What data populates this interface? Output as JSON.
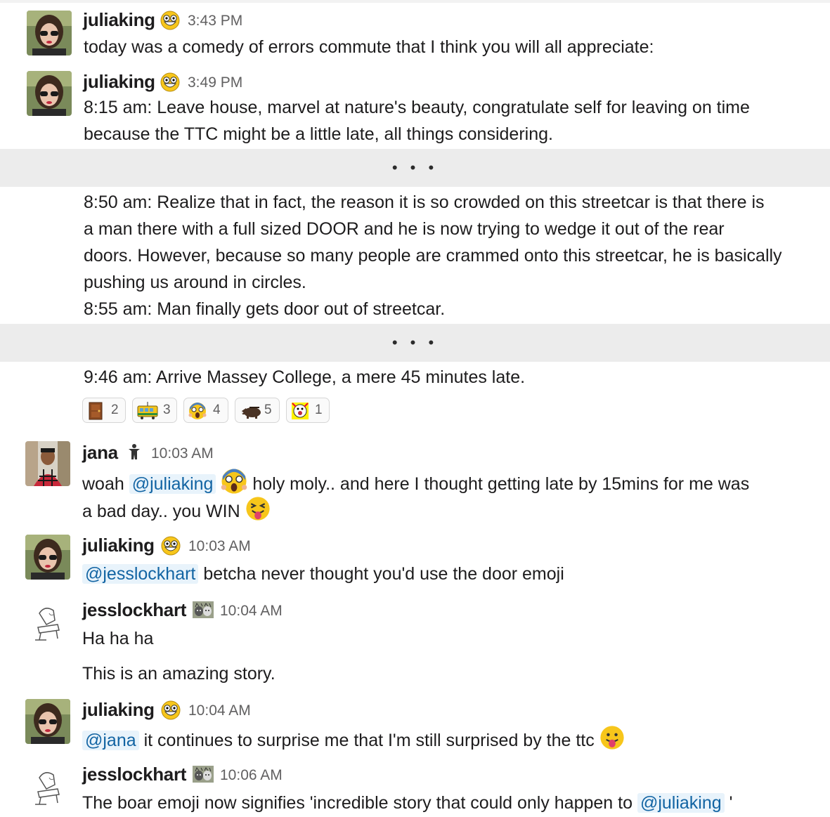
{
  "messages": [
    {
      "user": "juliaking",
      "time": "3:43 PM",
      "lines": [
        "today was a comedy of errors commute that I think you will all appreciate:"
      ]
    },
    {
      "user": "juliaking",
      "time": "3:49 PM",
      "lines": [
        "8:15 am: Leave house, marvel at nature's beauty, congratulate self for leaving on time",
        "because the TTC might be a little late, all things considering."
      ]
    },
    {
      "lines": [
        "8:50 am: Realize that in fact, the reason it is so crowded on this streetcar is that there is",
        "a man there with a full sized DOOR and he is now trying to wedge it out of the rear",
        "doors. However, because so many people are crammed onto this streetcar, he is basically",
        "pushing us around in circles.",
        "8:55 am: Man finally gets door out of streetcar."
      ]
    },
    {
      "lines": [
        "9:46 am: Arrive Massey College, a mere 45 minutes late."
      ]
    },
    {
      "user": "jana",
      "time": "10:03 AM",
      "text_a": "woah ",
      "mention": "@juliaking",
      "text_b": " holy moly.. and here I thought getting late by 15mins for me was",
      "line2": "a bad day.. you WIN "
    },
    {
      "user": "juliaking",
      "time": "10:03 AM",
      "mention": "@jesslockhart",
      "text": " betcha never thought you'd use the door emoji"
    },
    {
      "user": "jesslockhart",
      "time": "10:04 AM",
      "lines": [
        "Ha ha ha",
        "This is an amazing story."
      ]
    },
    {
      "user": "juliaking",
      "time": "10:04 AM",
      "mention": "@jana",
      "text": " it continues to surprise me that I'm still surprised by the ttc "
    },
    {
      "user": "jesslockhart",
      "time": "10:06 AM",
      "text": "The boar emoji now signifies 'incredible story that could only happen to ",
      "mention": "@juliaking",
      "text_end": " '"
    }
  ],
  "divider": "• • •",
  "reactions": [
    {
      "emoji": "door",
      "count": "2"
    },
    {
      "emoji": "tram",
      "count": "3"
    },
    {
      "emoji": "scream",
      "count": "4"
    },
    {
      "emoji": "boar",
      "count": "5"
    },
    {
      "emoji": "party-face",
      "count": "1"
    }
  ],
  "colors": {
    "mention_bg": "#e8f3fb",
    "mention_text": "#1264a3",
    "divider_bg": "#ececec",
    "timestamp": "#616061"
  }
}
